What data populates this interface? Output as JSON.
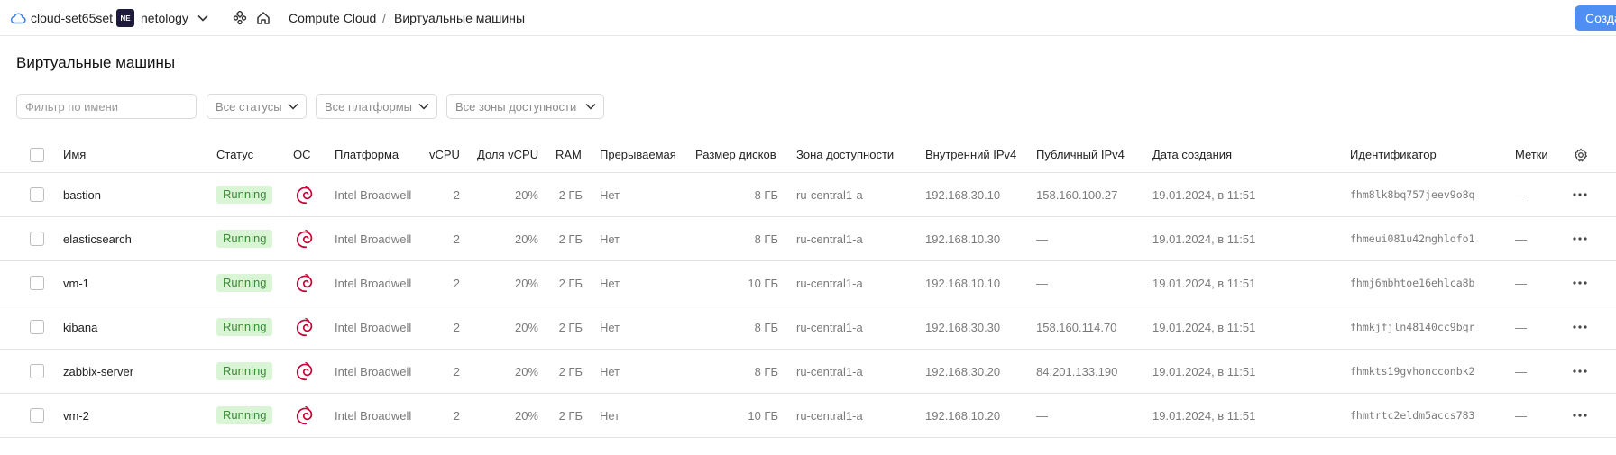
{
  "header": {
    "cloud_name": "cloud-set65set",
    "org_badge": "NE",
    "org_name": "netology",
    "breadcrumb_service": "Compute Cloud",
    "breadcrumb_separator": "/",
    "breadcrumb_current": "Виртуальные машины",
    "create_button": "Созда"
  },
  "page_title": "Виртуальные машины",
  "filters": {
    "name_placeholder": "Фильтр по имени",
    "status": "Все статусы",
    "platform": "Все платформы",
    "zone": "Все зоны доступности"
  },
  "table": {
    "columns": {
      "name": "Имя",
      "status": "Статус",
      "os": "ОС",
      "platform": "Платформа",
      "vcpu": "vCPU",
      "vcpu_share": "Доля vCPU",
      "ram": "RAM",
      "preemptible": "Прерываемая",
      "disk_size": "Размер дисков",
      "zone": "Зона доступности",
      "internal_ip": "Внутренний IPv4",
      "public_ip": "Публичный IPv4",
      "created": "Дата создания",
      "id": "Идентификатор",
      "labels": "Метки"
    },
    "rows": [
      {
        "name": "bastion",
        "status": "Running",
        "platform": "Intel Broadwell",
        "vcpu": "2",
        "vcpu_share": "20%",
        "ram": "2 ГБ",
        "preemptible": "Нет",
        "disk": "8 ГБ",
        "zone": "ru-central1-a",
        "internal_ip": "192.168.30.10",
        "public_ip": "158.160.100.27",
        "created": "19.01.2024, в 11:51",
        "id": "fhm8lk8bq757jeev9o8q",
        "labels": "—"
      },
      {
        "name": "elasticsearch",
        "status": "Running",
        "platform": "Intel Broadwell",
        "vcpu": "2",
        "vcpu_share": "20%",
        "ram": "2 ГБ",
        "preemptible": "Нет",
        "disk": "8 ГБ",
        "zone": "ru-central1-a",
        "internal_ip": "192.168.10.30",
        "public_ip": "—",
        "created": "19.01.2024, в 11:51",
        "id": "fhmeui081u42mghlofo1",
        "labels": "—"
      },
      {
        "name": "vm-1",
        "status": "Running",
        "platform": "Intel Broadwell",
        "vcpu": "2",
        "vcpu_share": "20%",
        "ram": "2 ГБ",
        "preemptible": "Нет",
        "disk": "10 ГБ",
        "zone": "ru-central1-a",
        "internal_ip": "192.168.10.10",
        "public_ip": "—",
        "created": "19.01.2024, в 11:51",
        "id": "fhmj6mbhtoe16ehlca8b",
        "labels": "—"
      },
      {
        "name": "kibana",
        "status": "Running",
        "platform": "Intel Broadwell",
        "vcpu": "2",
        "vcpu_share": "20%",
        "ram": "2 ГБ",
        "preemptible": "Нет",
        "disk": "8 ГБ",
        "zone": "ru-central1-a",
        "internal_ip": "192.168.30.30",
        "public_ip": "158.160.114.70",
        "created": "19.01.2024, в 11:51",
        "id": "fhmkjfjln48140cc9bqr",
        "labels": "—"
      },
      {
        "name": "zabbix-server",
        "status": "Running",
        "platform": "Intel Broadwell",
        "vcpu": "2",
        "vcpu_share": "20%",
        "ram": "2 ГБ",
        "preemptible": "Нет",
        "disk": "8 ГБ",
        "zone": "ru-central1-a",
        "internal_ip": "192.168.30.20",
        "public_ip": "84.201.133.190",
        "created": "19.01.2024, в 11:51",
        "id": "fhmkts19gvhoncconbk2",
        "labels": "—"
      },
      {
        "name": "vm-2",
        "status": "Running",
        "platform": "Intel Broadwell",
        "vcpu": "2",
        "vcpu_share": "20%",
        "ram": "2 ГБ",
        "preemptible": "Нет",
        "disk": "10 ГБ",
        "zone": "ru-central1-a",
        "internal_ip": "192.168.10.20",
        "public_ip": "—",
        "created": "19.01.2024, в 11:51",
        "id": "fhmtrtc2eldm5accs783",
        "labels": "—"
      }
    ]
  },
  "colors": {
    "accent": "#4f8ef2",
    "status_running_bg": "#d9f5d6",
    "status_running_text": "#3a8a35",
    "os_icon": "#c70036"
  },
  "icons": {
    "cloud": "cloud-icon",
    "org_chevron": "chevron-down-icon",
    "services": "services-icon",
    "home": "home-icon",
    "os": "debian-icon",
    "settings": "gear-icon",
    "row_menu": "more-dots-icon"
  }
}
